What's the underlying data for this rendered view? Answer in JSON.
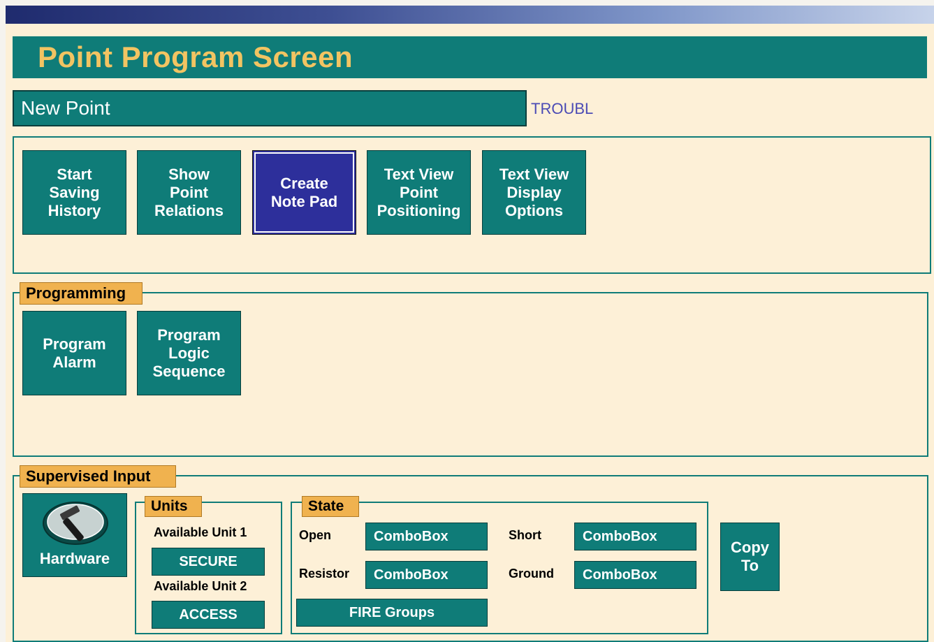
{
  "header": {
    "title": "Point Program Screen"
  },
  "point": {
    "name": "New Point",
    "status": "TROUBL"
  },
  "toolbar": {
    "buttons": [
      {
        "label": "Start\nSaving\nHistory"
      },
      {
        "label": "Show\nPoint\nRelations"
      },
      {
        "label": "Create\nNote Pad"
      },
      {
        "label": "Text View\nPoint\nPositioning"
      },
      {
        "label": "Text View\nDisplay\nOptions"
      }
    ]
  },
  "programming": {
    "title": "Programming",
    "buttons": [
      {
        "label": "Program\nAlarm"
      },
      {
        "label": "Program\nLogic\nSequence"
      }
    ]
  },
  "supervised": {
    "title": "Supervised Input",
    "hardware_label": "Hardware",
    "units": {
      "title": "Units",
      "unit1_label": "Available Unit 1",
      "unit1_value": "SECURE",
      "unit2_label": "Available Unit 2",
      "unit2_value": "ACCESS"
    },
    "state": {
      "title": "State",
      "open_label": "Open",
      "open_value": "ComboBox",
      "short_label": "Short",
      "short_value": "ComboBox",
      "resistor_label": "Resistor",
      "resistor_value": "ComboBox",
      "ground_label": "Ground",
      "ground_value": "ComboBox",
      "fire_groups_label": "FIRE Groups"
    },
    "copy_to_label": "Copy\nTo"
  },
  "colors": {
    "teal": "#0f7c78",
    "cream": "#fdf0d7",
    "title_gold": "#f2c462",
    "tab_gold": "#f0b24f",
    "selected_navy": "#2d2f9b",
    "status_blue": "#4b4bb5"
  }
}
